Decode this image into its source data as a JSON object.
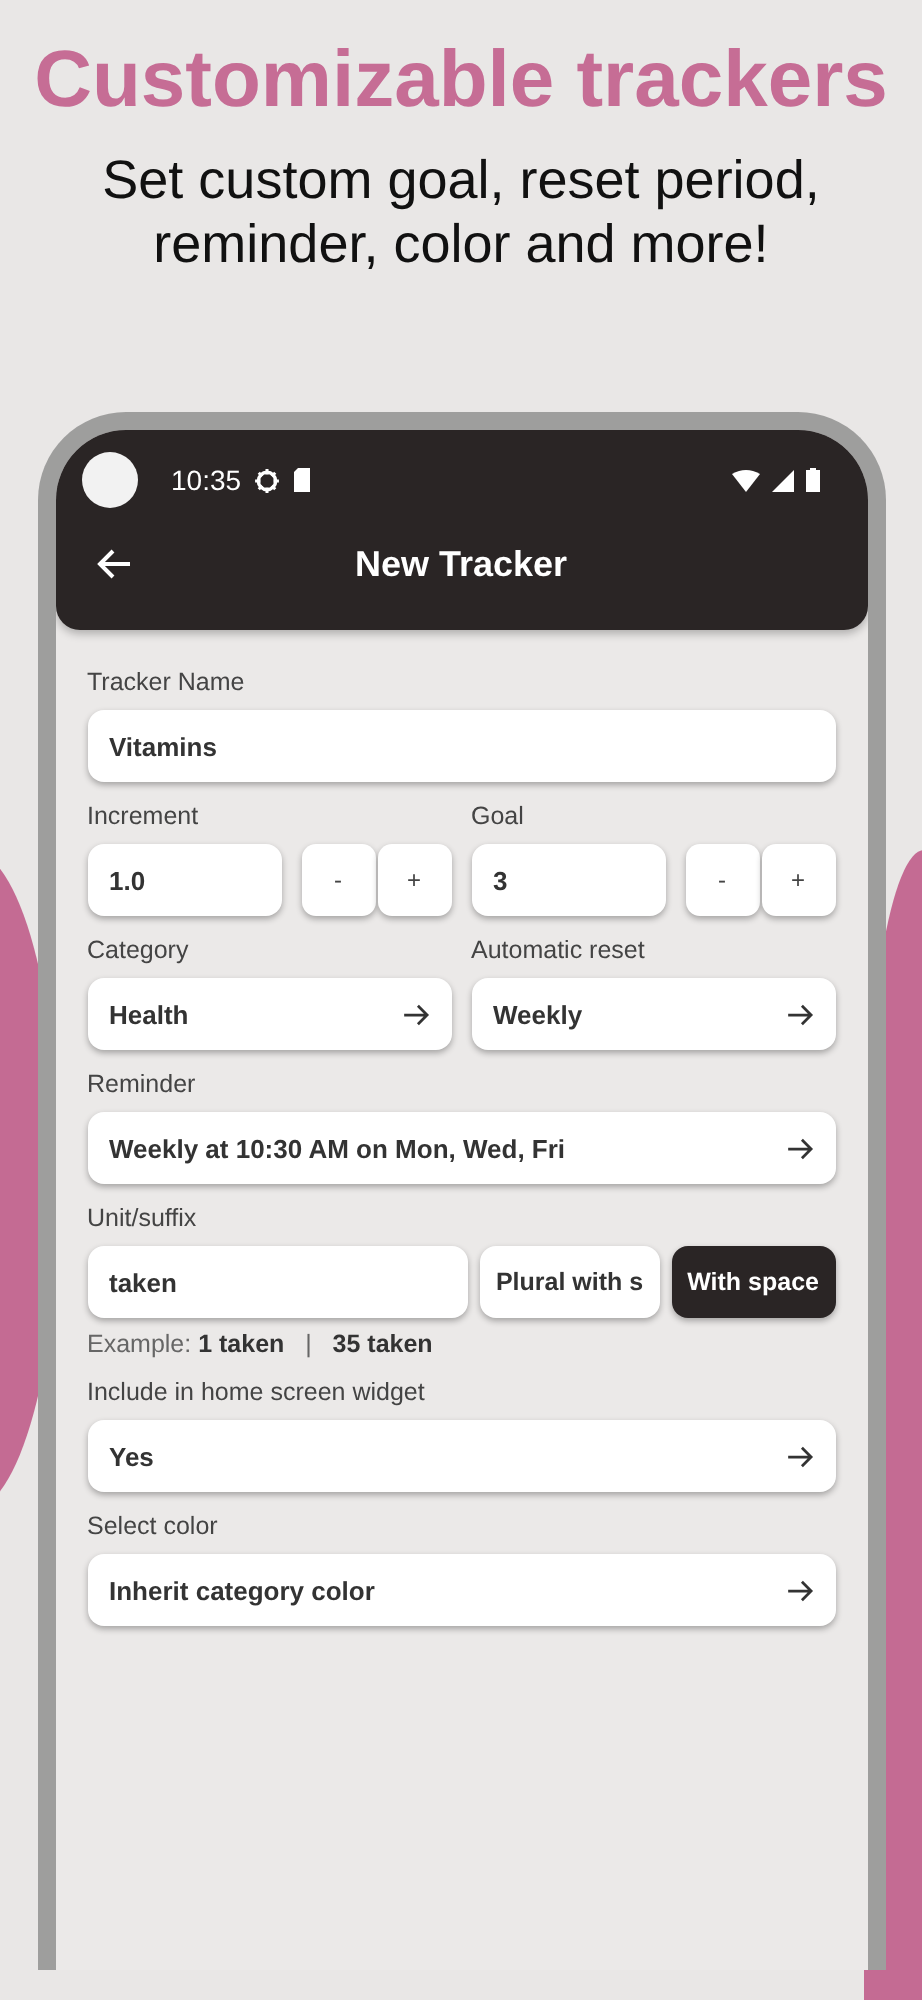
{
  "headline": "Customizable trackers",
  "subtitle": [
    "Set custom goal, reset period,",
    "reminder, color and more!"
  ],
  "status_bar": {
    "time": "10:35"
  },
  "app_bar": {
    "title": "New Tracker"
  },
  "form": [
    {
      "kind": "text",
      "label": "Tracker Name",
      "value": "Vitamins"
    },
    {
      "kind": "steppers",
      "items": [
        {
          "label": "Increment",
          "value": "1.0",
          "minus": "-",
          "plus": "+"
        },
        {
          "label": "Goal",
          "value": "3",
          "minus": "-",
          "plus": "+"
        }
      ]
    },
    {
      "kind": "selectors",
      "items": [
        {
          "label": "Category",
          "value": "Health"
        },
        {
          "label": "Automatic reset",
          "value": "Weekly"
        }
      ]
    },
    {
      "kind": "selector",
      "label": "Reminder",
      "value": "Weekly at 10:30 AM on Mon, Wed, Fri"
    },
    {
      "kind": "unit",
      "label": "Unit/suffix",
      "value": "taken",
      "options": [
        {
          "label": "Plural with s",
          "selected": false
        },
        {
          "label": "With space",
          "selected": true
        }
      ]
    },
    {
      "kind": "note",
      "text": "Example: **1 taken**   |   **35 taken**"
    },
    {
      "kind": "selector",
      "label": "Include in home screen widget",
      "value": "Yes"
    },
    {
      "kind": "selector",
      "label": "Select color",
      "value": "Inherit category color"
    }
  ]
}
